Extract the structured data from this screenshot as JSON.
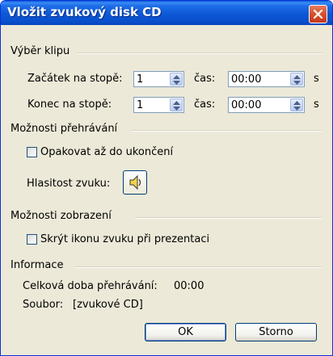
{
  "window": {
    "title": "Vložit zvukový disk CD"
  },
  "clip": {
    "section_label": "Výběr klipu",
    "start_track_label": "Začátek na stopě:",
    "start_track_value": "1",
    "start_time_label": "čas:",
    "start_time_value": "00:00",
    "start_unit": "s",
    "end_track_label": "Konec na stopě:",
    "end_track_value": "1",
    "end_time_label": "čas:",
    "end_time_value": "00:00",
    "end_unit": "s"
  },
  "playback": {
    "section_label": "Možnosti přehrávání",
    "loop_label": "Opakovat až do ukončení",
    "loop_checked": false,
    "volume_label": "Hlasitost zvuku:",
    "volume_icon": "speaker-icon"
  },
  "display": {
    "section_label": "Možnosti zobrazení",
    "hide_icon_label": "Skrýt ikonu zvuku při prezentaci",
    "hide_icon_checked": false
  },
  "info": {
    "section_label": "Informace",
    "total_time_label": "Celková doba přehrávání:",
    "total_time_value": "00:00",
    "file_label": "Soubor:",
    "file_value": "[zvukové CD]"
  },
  "buttons": {
    "ok": "OK",
    "cancel": "Storno"
  }
}
